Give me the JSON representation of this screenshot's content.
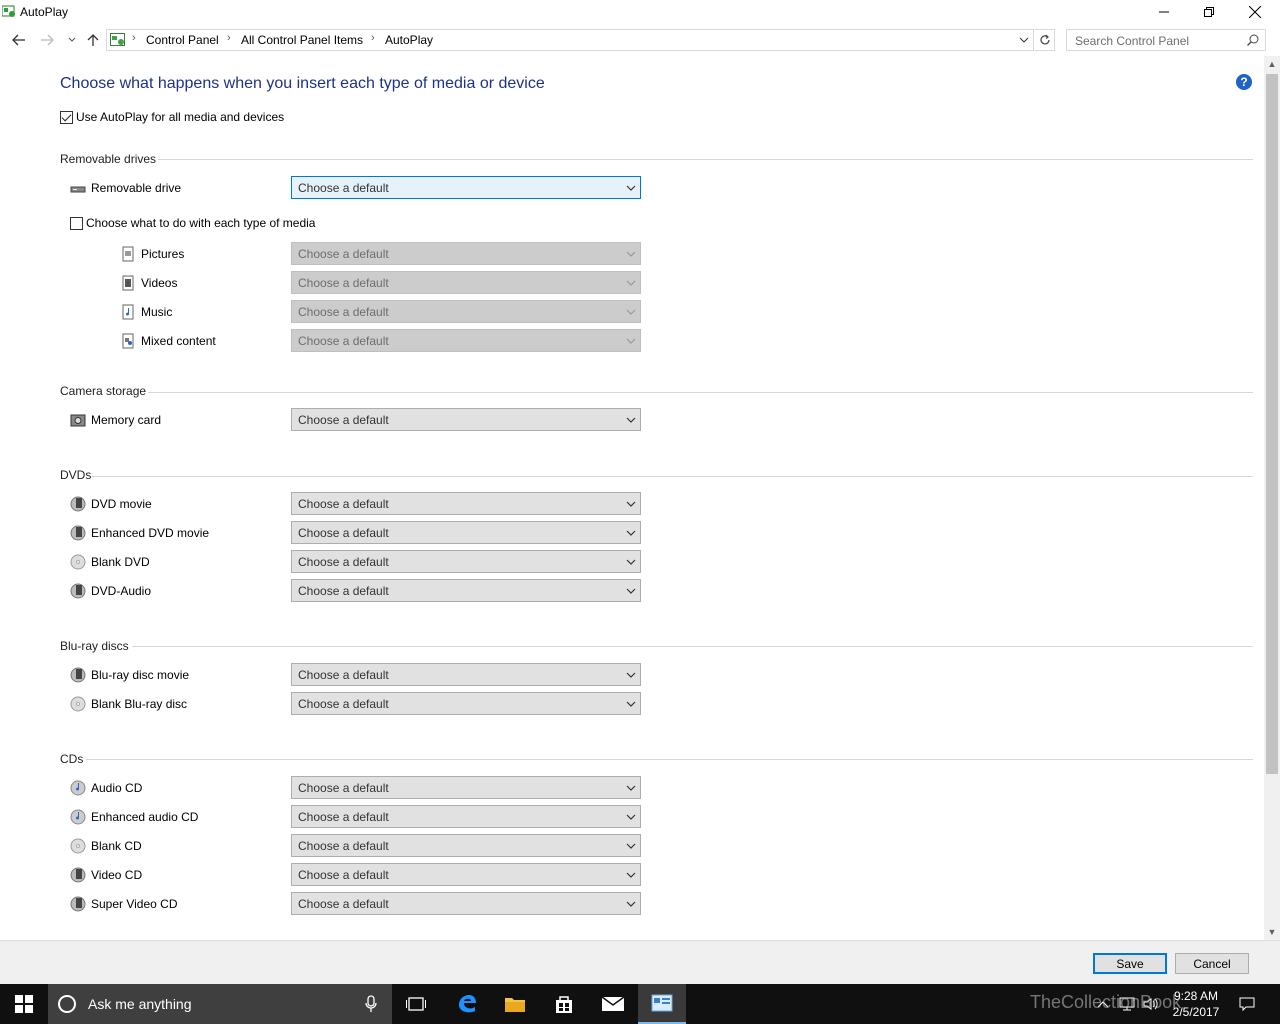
{
  "window": {
    "title": "AutoPlay"
  },
  "address": {
    "crumbs": [
      "Control Panel",
      "All Control Panel Items",
      "AutoPlay"
    ]
  },
  "search": {
    "placeholder": "Search Control Panel"
  },
  "page": {
    "heading": "Choose what happens when you insert each type of media or device",
    "use_autoplay_label": "Use AutoPlay for all media and devices",
    "use_autoplay_checked": true
  },
  "sections": {
    "removable": {
      "title": "Removable drives",
      "drive_label": "Removable drive",
      "drive_value": "Choose a default",
      "each_type_label": "Choose what to do with each type of media",
      "each_type_checked": false,
      "media": [
        {
          "label": "Pictures",
          "value": "Choose a default"
        },
        {
          "label": "Videos",
          "value": "Choose a default"
        },
        {
          "label": "Music",
          "value": "Choose a default"
        },
        {
          "label": "Mixed content",
          "value": "Choose a default"
        }
      ]
    },
    "camera": {
      "title": "Camera storage",
      "items": [
        {
          "label": "Memory card",
          "value": "Choose a default"
        }
      ]
    },
    "dvds": {
      "title": "DVDs",
      "items": [
        {
          "label": "DVD movie",
          "value": "Choose a default"
        },
        {
          "label": "Enhanced DVD movie",
          "value": "Choose a default"
        },
        {
          "label": "Blank DVD",
          "value": "Choose a default"
        },
        {
          "label": "DVD-Audio",
          "value": "Choose a default"
        }
      ]
    },
    "bluray": {
      "title": "Blu-ray discs",
      "items": [
        {
          "label": "Blu-ray disc movie",
          "value": "Choose a default"
        },
        {
          "label": "Blank Blu-ray disc",
          "value": "Choose a default"
        }
      ]
    },
    "cds": {
      "title": "CDs",
      "items": [
        {
          "label": "Audio CD",
          "value": "Choose a default"
        },
        {
          "label": "Enhanced audio CD",
          "value": "Choose a default"
        },
        {
          "label": "Blank CD",
          "value": "Choose a default"
        },
        {
          "label": "Video CD",
          "value": "Choose a default"
        },
        {
          "label": "Super Video CD",
          "value": "Choose a default"
        }
      ]
    }
  },
  "footer": {
    "save_label": "Save",
    "cancel_label": "Cancel"
  },
  "taskbar": {
    "search_placeholder": "Ask me anything",
    "time": "9:28 AM",
    "date": "2/5/2017",
    "watermark": "TheCollectionBook"
  },
  "colors": {
    "heading": "#1e3287",
    "accent": "#0078d7",
    "taskbar": "#101010"
  }
}
